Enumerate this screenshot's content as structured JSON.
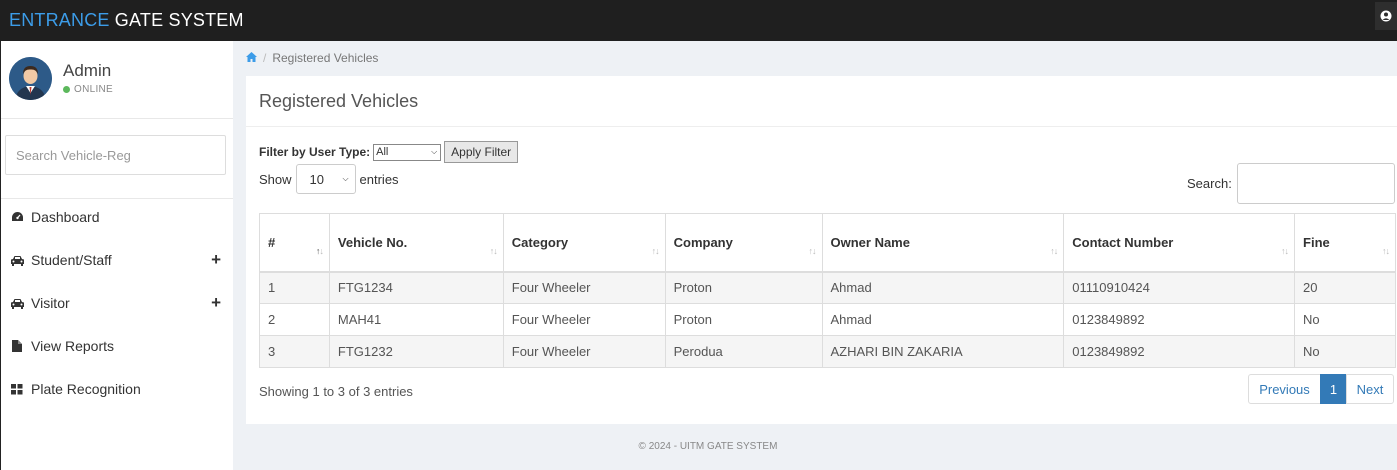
{
  "app": {
    "brand_part1": "ENTRANCE",
    "brand_part2": " GATE SYSTEM"
  },
  "sidebar": {
    "user_name": "Admin",
    "status": "ONLINE",
    "search_placeholder": "Search Vehicle-Reg",
    "items": [
      {
        "label": "Dashboard",
        "icon": "dashboard-icon",
        "expandable": false
      },
      {
        "label": "Student/Staff",
        "icon": "car-icon",
        "expandable": true
      },
      {
        "label": "Visitor",
        "icon": "car-icon",
        "expandable": true
      },
      {
        "label": "View Reports",
        "icon": "file-icon",
        "expandable": false
      },
      {
        "label": "Plate Recognition",
        "icon": "grid-icon",
        "expandable": false
      }
    ]
  },
  "breadcrumb": {
    "current": "Registered Vehicles"
  },
  "panel": {
    "title": "Registered Vehicles",
    "filter_label": "Filter by User Type:",
    "filter_value": "All",
    "apply_label": "Apply Filter",
    "show_label": "Show",
    "page_length": "10",
    "entries_label": "entries",
    "search_label": "Search:"
  },
  "table": {
    "columns": [
      "#",
      "Vehicle No.",
      "Category",
      "Company",
      "Owner Name",
      "Contact Number",
      "Fine"
    ],
    "rows": [
      [
        "1",
        "FTG1234",
        "Four Wheeler",
        "Proton",
        "Ahmad",
        "01110910424",
        "20"
      ],
      [
        "2",
        "MAH41",
        "Four Wheeler",
        "Proton",
        "Ahmad",
        "0123849892",
        "No"
      ],
      [
        "3",
        "FTG1232",
        "Four Wheeler",
        "Perodua",
        "AZHARI BIN ZAKARIA",
        "0123849892",
        "No"
      ]
    ]
  },
  "pagination": {
    "info": "Showing 1 to 3 of 3 entries",
    "previous": "Previous",
    "current_page": "1",
    "next": "Next"
  },
  "footer": {
    "text": "© 2024 - UITM GATE SYSTEM"
  },
  "colors": {
    "brand_accent": "#3c9ce8",
    "topbar": "#1f1f1f",
    "online": "#5cb85c",
    "page_active": "#337ab7"
  }
}
